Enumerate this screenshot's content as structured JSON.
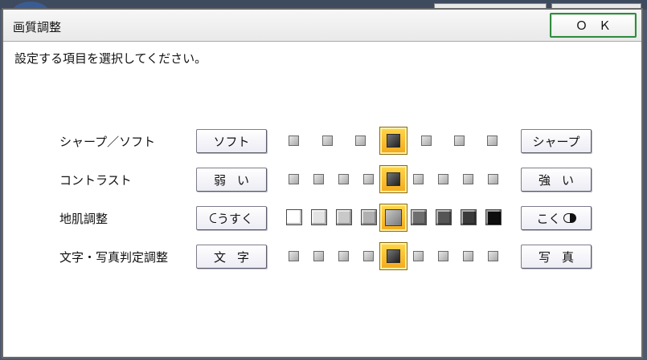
{
  "dialog": {
    "title": "画質調整",
    "ok_label": "ＯＫ",
    "instruction": "設定する項目を選択してください。"
  },
  "rows": [
    {
      "label": "シャープ／ソフト",
      "left_button": "ソフト",
      "right_button": "シャープ",
      "levels": 7,
      "selected": 4
    },
    {
      "label": "コントラスト",
      "left_button": "弱い",
      "right_button": "強い",
      "levels": 9,
      "selected": 5
    },
    {
      "label": "地肌調整",
      "left_button": "うすく",
      "right_button": "こく",
      "levels": 9,
      "selected": 5
    },
    {
      "label": "文字・写真判定調整",
      "left_button": "文字",
      "right_button": "写真",
      "levels": 9,
      "selected": 5
    }
  ],
  "colors": {
    "ok_border": "#2f8a3c",
    "selected_fill": "#f3a91b"
  },
  "icons": {
    "left_half_circle": "half-circle-outline-icon",
    "right_half_circle": "half-circle-filled-icon"
  }
}
